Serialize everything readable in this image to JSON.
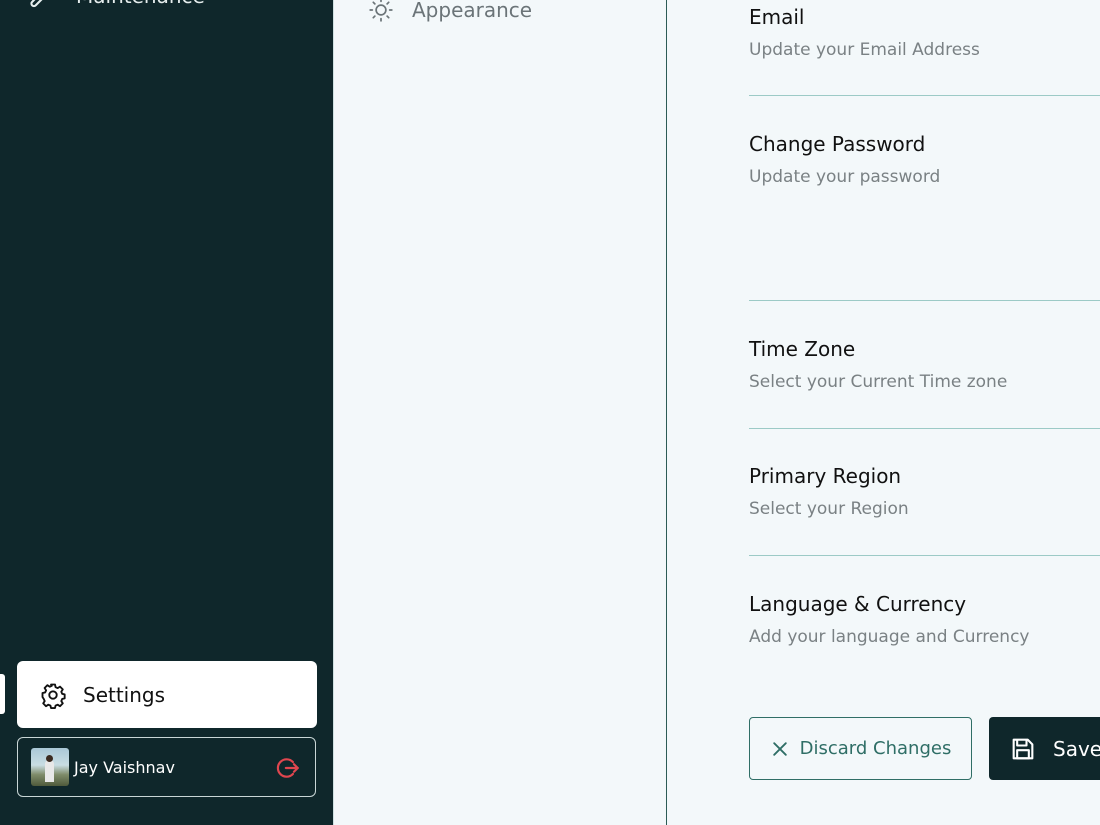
{
  "sidebar": {
    "top_item_label": "Maintenance",
    "settings_label": "Settings",
    "user": {
      "name": "Jay Vaishnav"
    }
  },
  "settings_nav": {
    "appearance_label": "Appearance"
  },
  "sections": {
    "email": {
      "title": "Email",
      "desc": "Update your Email Address"
    },
    "password": {
      "title": "Change Password",
      "desc": "Update your password"
    },
    "timezone": {
      "title": "Time Zone",
      "desc": "Select your Current Time zone"
    },
    "region": {
      "title": "Primary Region",
      "desc": "Select your Region"
    },
    "language": {
      "title": "Language & Currency",
      "desc": "Add your language and Currency"
    }
  },
  "actions": {
    "discard_label": "Discard Changes",
    "save_label": "Save"
  },
  "colors": {
    "sidebar_bg": "#0f272b",
    "page_bg": "#f3f8fa",
    "accent": "#2f6e66",
    "logout": "#e0464f"
  }
}
